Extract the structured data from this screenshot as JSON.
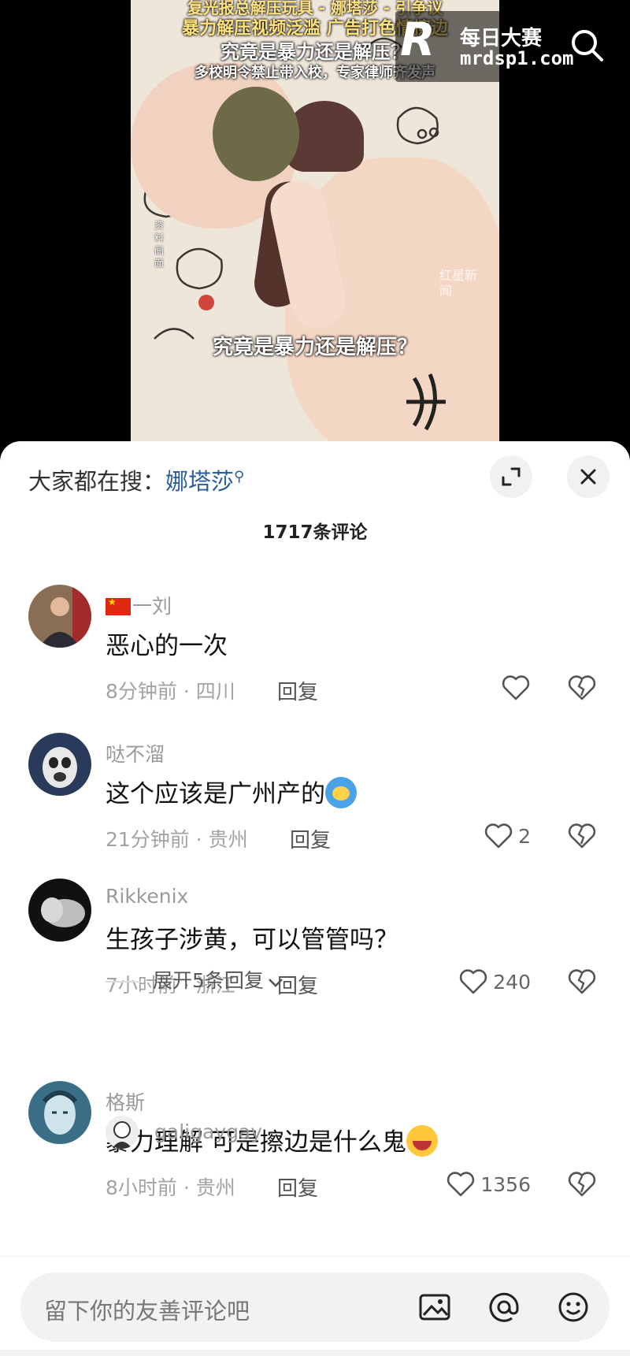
{
  "video": {
    "headline_line1": "复光报总解压玩具 - 娜塔莎 - 引争议",
    "headline_line2": "暴力解压视频泛滥 广告打色情擦边",
    "headline_line3": "究竟是暴力还是解压？",
    "headline_line4": "多校明令禁止带入校，专家律师齐发声",
    "vertical_label": "资料画面",
    "source_watermark": "红星新闻",
    "subtitle": "究竟是暴力还是解压？",
    "brand_letter": "R",
    "brand_name": "每日大赛",
    "brand_url": "mrdsp1.com"
  },
  "sheet": {
    "trending_label": "大家都在搜：",
    "trending_term": "娜塔莎",
    "comment_count": "1717条评论"
  },
  "comments": [
    {
      "username": "一刘",
      "text": "恶心的一次",
      "time_location": "8分钟前 · 四川",
      "reply": "回复",
      "likes": ""
    },
    {
      "username": "哒不溜",
      "text": "这个应该是广州产的",
      "time_location": "21分钟前 · 贵州",
      "reply": "回复",
      "likes": "2"
    },
    {
      "username": "Rikkenix",
      "text": "生孩子涉黄，可以管管吗？",
      "time_location": "7小时前 · 浙江",
      "reply": "回复",
      "likes": "240"
    },
    {
      "username": "格斯",
      "text": "暴力理解 可是擦边是什么鬼",
      "time_location": "8小时前 · 贵州",
      "reply": "回复",
      "likes": "1356"
    }
  ],
  "expand_replies": "展开5条回复",
  "peek_reply_username": "galigaygay",
  "input": {
    "placeholder": "留下你的友善评论吧"
  },
  "colors": {
    "link": "#2a5e9c",
    "meta": "#a3a3a3",
    "sheet_bg": "#ffffff"
  },
  "icons": [
    "search-icon",
    "expand-icon",
    "close-icon",
    "heart-icon",
    "dislike-heart-icon",
    "image-icon",
    "at-icon",
    "emoji-icon",
    "chevron-down-icon"
  ]
}
